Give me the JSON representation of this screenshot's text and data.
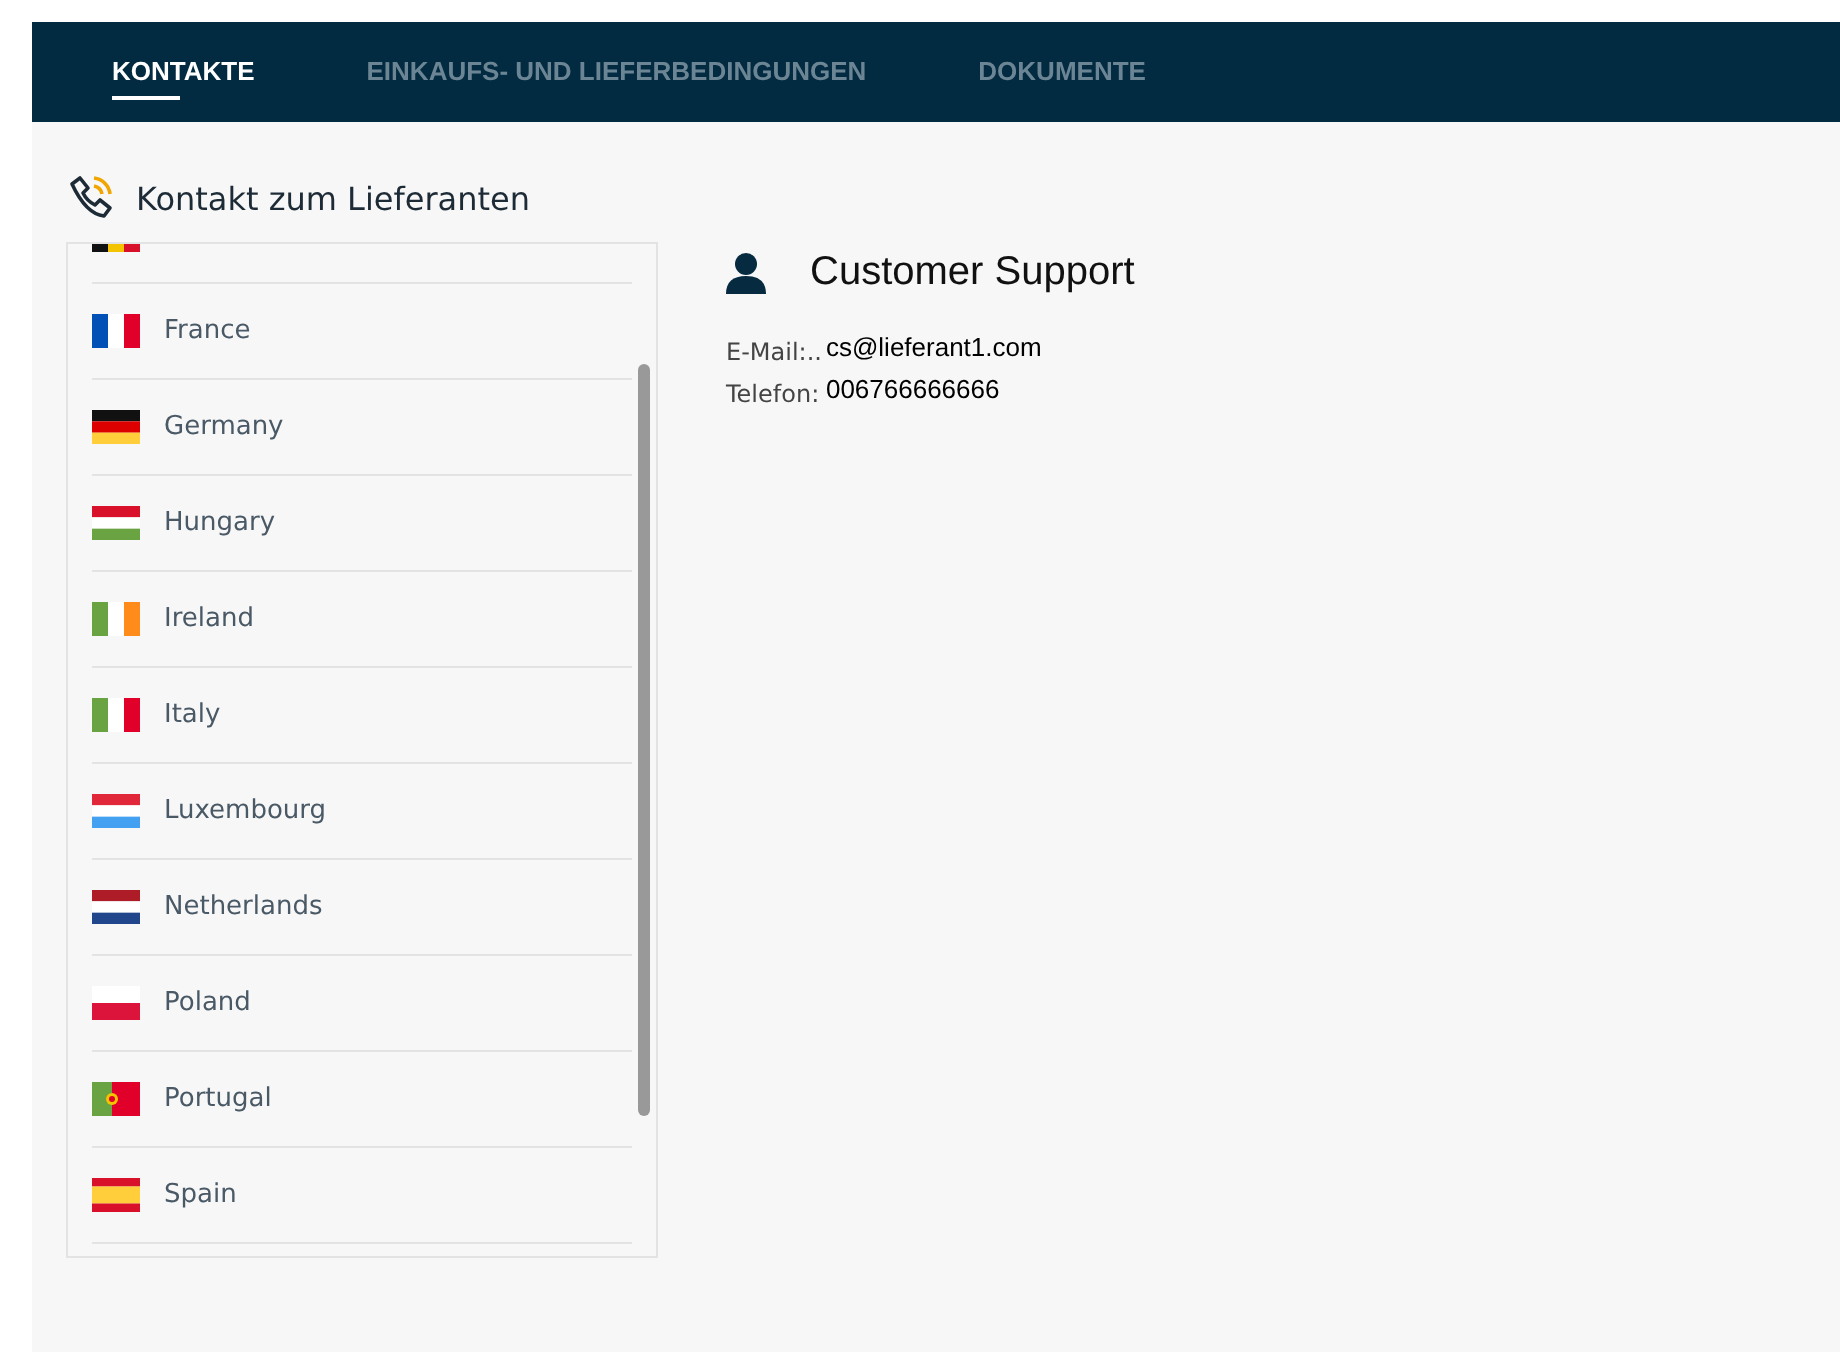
{
  "tabs": [
    {
      "label": "KONTAKTE",
      "selected": true
    },
    {
      "label": "EINKAUFS- UND LIEFERBEDINGUNGEN",
      "selected": false
    },
    {
      "label": "DOKUMENTE",
      "selected": false
    }
  ],
  "section_title": "Kontakt zum Lieferanten",
  "countries": [
    {
      "kind": "be"
    },
    {
      "kind": "fr",
      "name": "France"
    },
    {
      "kind": "de",
      "name": "Germany"
    },
    {
      "kind": "hu",
      "name": "Hungary"
    },
    {
      "kind": "ie",
      "name": "Ireland"
    },
    {
      "kind": "it",
      "name": "Italy"
    },
    {
      "kind": "lu",
      "name": "Luxembourg"
    },
    {
      "kind": "nl",
      "name": "Netherlands"
    },
    {
      "kind": "pl",
      "name": "Poland"
    },
    {
      "kind": "pt",
      "name": "Portugal"
    },
    {
      "kind": "es",
      "name": "Spain"
    }
  ],
  "contact": {
    "title": "Customer Support",
    "fields": [
      {
        "label": "E-Mail:..",
        "value": "cs@lieferant1.com"
      },
      {
        "label": "Telefon:",
        "value": "006766666666"
      }
    ]
  }
}
